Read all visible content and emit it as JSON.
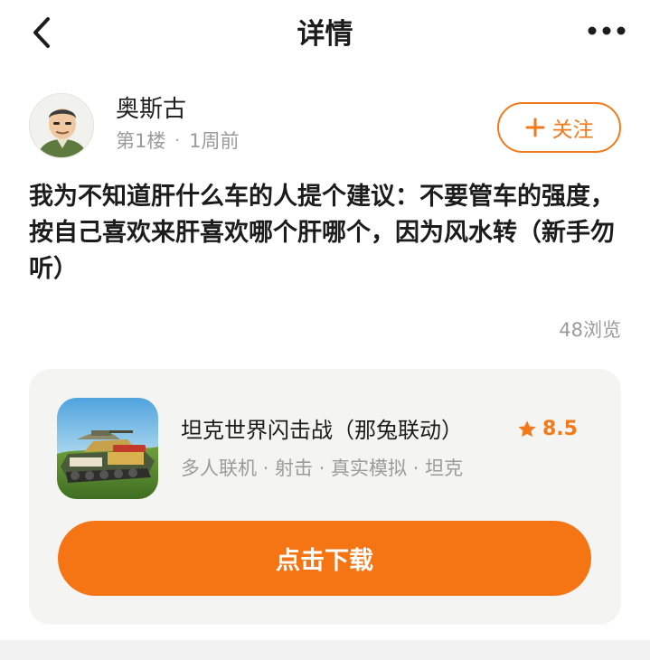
{
  "header": {
    "title": "详情",
    "back_icon": "chevron-left-icon",
    "more_icon": "more-horizontal-icon"
  },
  "post": {
    "author": "奥斯古",
    "floor": "第1楼",
    "separator": "·",
    "time": "1周前",
    "follow_label": "关注",
    "follow_icon": "plus-icon",
    "content": "我为不知道肝什么车的人提个建议：不要管车的强度，按自己喜欢来肝喜欢哪个肝哪个，因为风水转（新手勿听）",
    "views": "48浏览"
  },
  "game_card": {
    "name": "坦克世界闪击战（那兔联动）",
    "rating": "8.5",
    "rating_icon": "star-icon",
    "tags": "多人联机 · 射击 · 真实模拟 · 坦克",
    "download_label": "点击下载"
  },
  "colors": {
    "accent": "#f57414",
    "text_primary": "#1c1c1c",
    "text_secondary": "#9b9b9b",
    "card_bg": "#f4f4f2"
  }
}
